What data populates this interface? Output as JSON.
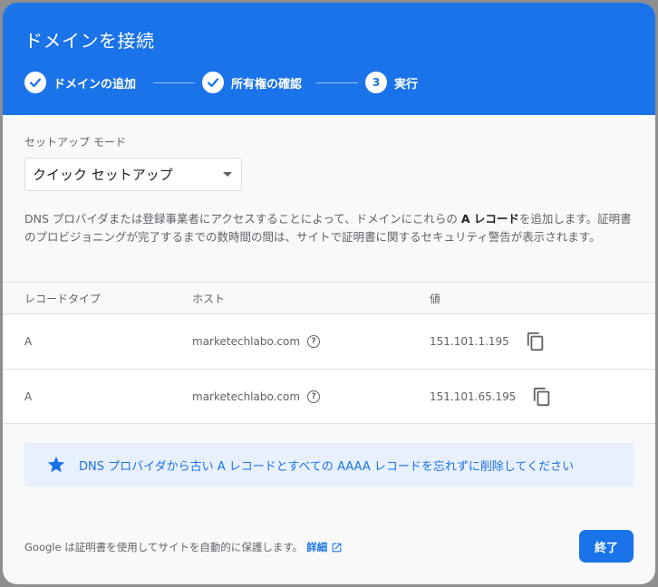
{
  "dialog": {
    "title": "ドメインを接続",
    "steps": [
      {
        "label": "ドメインの追加",
        "state": "done"
      },
      {
        "label": "所有権の確認",
        "state": "done"
      },
      {
        "number": "3",
        "label": "実行",
        "state": "active"
      }
    ],
    "setup_mode": {
      "label": "セットアップ モード",
      "selected": "クイック セットアップ"
    },
    "description": {
      "before": "DNS プロバイダまたは登録事業者にアクセスすることによって、ドメインにこれらの ",
      "bold": "A レコード",
      "after": "を追加します。証明書のプロビジョニングが完了するまでの数時間の間は、サイトで証明書に関するセキュリティ警告が表示されます。"
    },
    "table": {
      "headers": [
        "レコードタイプ",
        "ホスト",
        "値"
      ],
      "rows": [
        {
          "type": "A",
          "host": "marketechlabo.com",
          "value": "151.101.1.195"
        },
        {
          "type": "A",
          "host": "marketechlabo.com",
          "value": "151.101.65.195"
        }
      ]
    },
    "notice": "DNS プロバイダから古い A レコードとすべての AAAA レコードを忘れずに削除してください",
    "footer": {
      "text": "Google は証明書を使用してサイトを自動的に保護します。",
      "link": "詳細"
    },
    "done_label": "終了",
    "colors": {
      "accent": "#1a73e8",
      "notice_bg": "#e8f0fe"
    }
  }
}
